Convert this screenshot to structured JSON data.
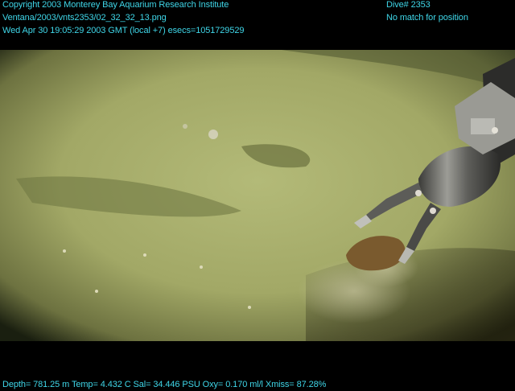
{
  "header": {
    "copyright": "Copyright 2003 Monterey Bay Aquarium Research Institute",
    "file_path": "Ventana/2003/vnts2353/02_32_32_13.png",
    "timestamp": "Wed Apr 30 19:05:29 2003 GMT (local +7)  esecs=1051729529",
    "dive": "Dive# 2353",
    "position_status": "No match for position"
  },
  "footer": {
    "telemetry": "Depth= 781.25 m  Temp= 4.432 C  Sal= 34.446 PSU  Oxy= 0.170 ml/l  Xmiss= 87.28%"
  },
  "scene": {
    "description_icon": "underwater-seafloor-with-robotic-arm",
    "colors": {
      "sediment": "#a7b06a",
      "sediment_dark": "#6f7640",
      "vignette": "#1a1f10",
      "arm_metal": "#8a8a86",
      "overlay_text": "#3fd6e8"
    }
  }
}
